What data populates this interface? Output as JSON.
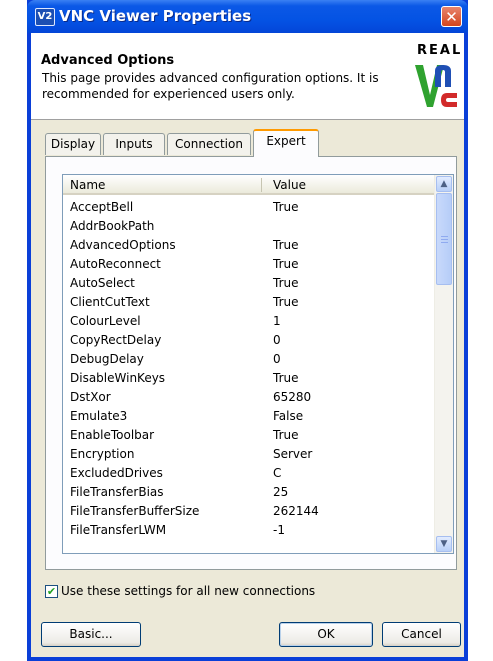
{
  "window": {
    "title": "VNC Viewer Properties",
    "icon_label": "V2",
    "close_glyph": "✕"
  },
  "header": {
    "title": "Advanced Options",
    "description": "This page provides advanced configuration options. It is recommended for experienced users only.",
    "logo_word": "REAL"
  },
  "tabs": [
    {
      "label": "Display"
    },
    {
      "label": "Inputs"
    },
    {
      "label": "Connection"
    },
    {
      "label": "Expert",
      "active": true
    }
  ],
  "list": {
    "columns": {
      "name": "Name",
      "value": "Value"
    },
    "rows": [
      {
        "name": "AcceptBell",
        "value": "True"
      },
      {
        "name": "AddrBookPath",
        "value": ""
      },
      {
        "name": "AdvancedOptions",
        "value": "True"
      },
      {
        "name": "AutoReconnect",
        "value": "True"
      },
      {
        "name": "AutoSelect",
        "value": "True"
      },
      {
        "name": "ClientCutText",
        "value": "True"
      },
      {
        "name": "ColourLevel",
        "value": "1"
      },
      {
        "name": "CopyRectDelay",
        "value": "0"
      },
      {
        "name": "DebugDelay",
        "value": "0"
      },
      {
        "name": "DisableWinKeys",
        "value": "True"
      },
      {
        "name": "DstXor",
        "value": "65280"
      },
      {
        "name": "Emulate3",
        "value": "False"
      },
      {
        "name": "EnableToolbar",
        "value": "True"
      },
      {
        "name": "Encryption",
        "value": "Server"
      },
      {
        "name": "ExcludedDrives",
        "value": "C"
      },
      {
        "name": "FileTransferBias",
        "value": "25"
      },
      {
        "name": "FileTransferBufferSize",
        "value": "262144"
      },
      {
        "name": "FileTransferLWM",
        "value": "-1"
      }
    ],
    "scroll_up_glyph": "▲",
    "scroll_down_glyph": "▼"
  },
  "options": {
    "use_for_all_label": "Use these settings for all new connections",
    "use_for_all_checked": true,
    "check_glyph": "✔"
  },
  "buttons": {
    "basic": "Basic...",
    "ok": "OK",
    "cancel": "Cancel"
  },
  "colors": {
    "title_bar": "#0453e4",
    "logo_green": "#2fa22f",
    "logo_blue": "#1f4fb5",
    "logo_red": "#d22a2a",
    "active_tab_accent": "#ff9a00"
  }
}
